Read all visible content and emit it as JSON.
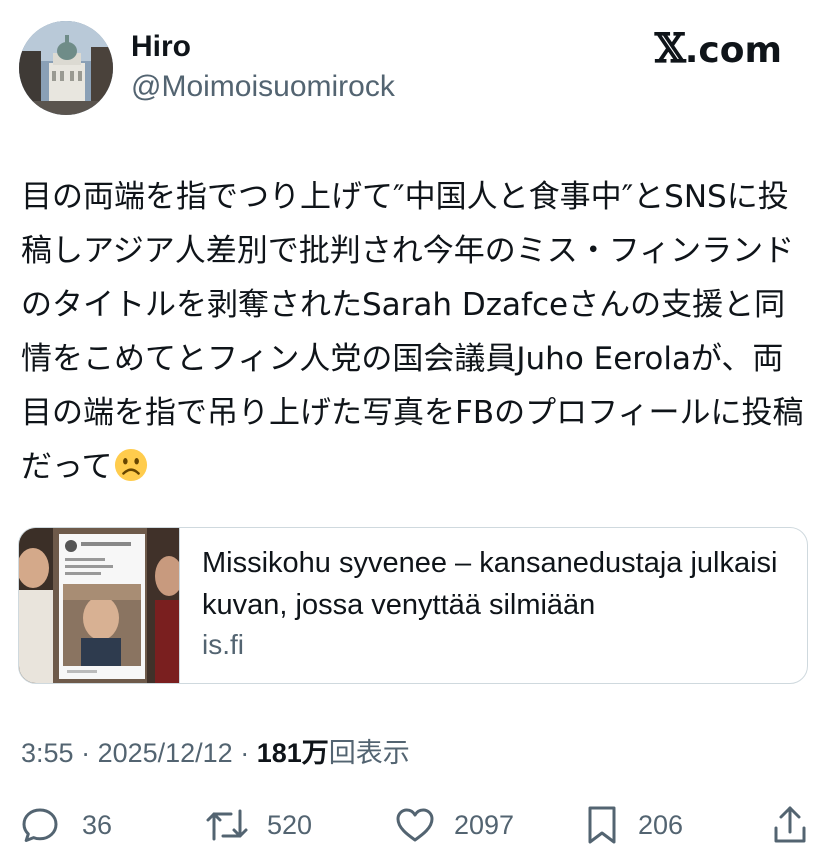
{
  "author": {
    "name": "Hiro",
    "handle": "@Moimoisuomirock"
  },
  "site_badge": {
    "mark": "𝕏",
    "suffix": ".com"
  },
  "tweet": {
    "text": "目の両端を指でつり上げて″中国人と食事中″とSNSに投稿しアジア人差別で批判され今年のミス・フィンランドのタイトルを剥奪されたSarah Dzafceさんの支援と同情をこめてとフィン人党の国会議員Juho Eerolaが、両目の端を指で吊り上げた写真をFBのプロフィールに投稿だって",
    "emoji": "frowning-face-emoji"
  },
  "link_card": {
    "title": "Missikohu syvenee – kansanedustaja julkaisi kuvan, jossa venyttää silmiään",
    "domain": "is.fi"
  },
  "meta": {
    "time": "3:55",
    "separator": " · ",
    "date": "2025/12/12",
    "views_count": "181万",
    "views_label": "回表示"
  },
  "actions": {
    "reply": {
      "icon": "reply-icon",
      "count": "36"
    },
    "repost": {
      "icon": "repost-icon",
      "count": "520"
    },
    "like": {
      "icon": "heart-icon",
      "count": "2097"
    },
    "bookmark": {
      "icon": "bookmark-icon",
      "count": "206"
    },
    "share": {
      "icon": "share-icon"
    }
  },
  "colors": {
    "text_primary": "#0f1419",
    "text_secondary": "#536471",
    "border": "#cfd9de"
  }
}
